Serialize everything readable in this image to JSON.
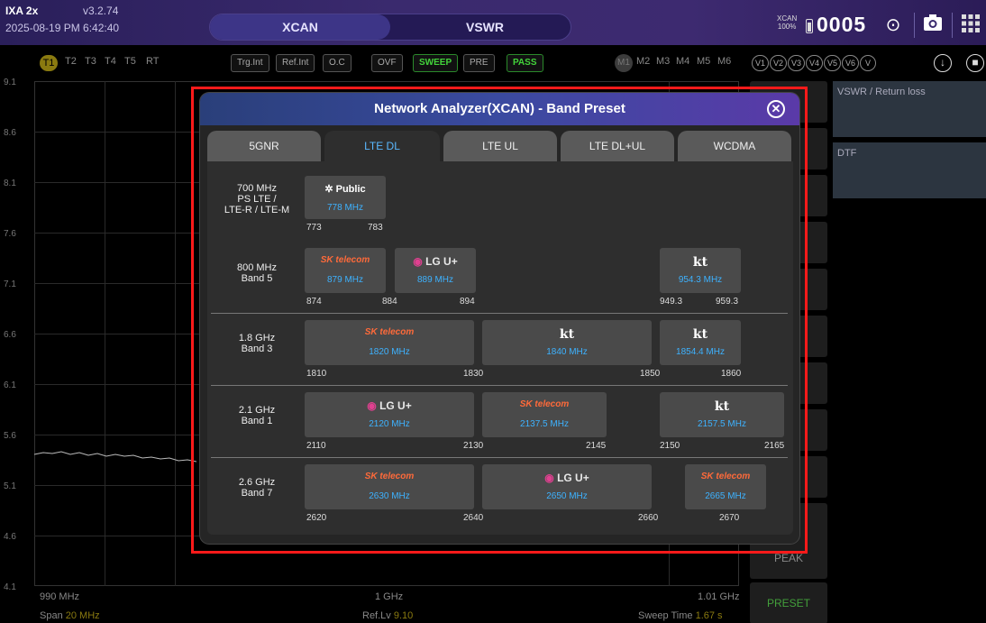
{
  "topbar": {
    "model": "IXA 2x",
    "version": "v3.2.74",
    "datetime": "2025-08-19 PM 6:42:40",
    "mode_a": "XCAN",
    "mode_b": "VSWR",
    "battery_label": "XCAN",
    "battery_pct": "100%",
    "counter": "0005"
  },
  "row2": {
    "traces": [
      "T1",
      "T2",
      "T3",
      "T4",
      "T5",
      "RT"
    ],
    "chips": [
      "Trg.Int",
      "Ref.Int",
      "O.C",
      "OVF",
      "SWEEP",
      "PRE",
      "PASS"
    ],
    "markers": [
      "M1",
      "M2",
      "M3",
      "M4",
      "M5",
      "M6"
    ],
    "vchips": [
      "V1",
      "V2",
      "V3",
      "V4",
      "V5",
      "V6",
      "V"
    ]
  },
  "plot": {
    "y_ticks": [
      "9.1",
      "8.6",
      "8.1",
      "7.6",
      "7.1",
      "6.6",
      "6.1",
      "5.6",
      "5.1",
      "4.6",
      "4.1"
    ],
    "x_start": "990 MHz",
    "x_center": "1 GHz",
    "x_end": "1.01 GHz",
    "span_label": "Span",
    "span_value": "20 MHz",
    "reflv_label": "Ref.Lv",
    "reflv_value": "9.10",
    "sweep_label": "Sweep Time",
    "sweep_value": "1.67 s"
  },
  "softkeys": {
    "peak": "PEAK",
    "preset": "PRESET"
  },
  "right_panel": {
    "vswr": "VSWR / Return loss",
    "dtf": "DTF"
  },
  "modal": {
    "title": "Network Analyzer(XCAN) - Band Preset",
    "tabs": [
      "5GNR",
      "LTE DL",
      "LTE UL",
      "LTE DL+UL",
      "WCDMA"
    ],
    "active_tab": "LTE DL",
    "bands": [
      {
        "name": "700 MHz\nPS LTE /\nLTE-R / LTE-M",
        "cells": [
          {
            "operator": "Public",
            "freq": "778 MHz"
          }
        ],
        "ticks": [
          "773",
          "783"
        ]
      },
      {
        "name": "800 MHz\nBand 5",
        "cells": [
          {
            "operator": "SK telecom",
            "freq": "879 MHz"
          },
          {
            "operator": "LG U+",
            "freq": "889 MHz"
          },
          {
            "operator": "kt",
            "freq": "954.3 MHz"
          }
        ],
        "ticks": [
          "874",
          "884",
          "894",
          "949.3",
          "959.3"
        ]
      },
      {
        "name": "1.8 GHz\nBand 3",
        "cells": [
          {
            "operator": "SK telecom",
            "freq": "1820 MHz"
          },
          {
            "operator": "kt",
            "freq": "1840 MHz"
          },
          {
            "operator": "kt",
            "freq": "1854.4 MHz"
          }
        ],
        "ticks": [
          "1810",
          "1830",
          "1850",
          "1860"
        ]
      },
      {
        "name": "2.1 GHz\nBand 1",
        "cells": [
          {
            "operator": "LG U+",
            "freq": "2120 MHz"
          },
          {
            "operator": "SK telecom",
            "freq": "2137.5 MHz"
          },
          {
            "operator": "kt",
            "freq": "2157.5 MHz"
          }
        ],
        "ticks": [
          "2110",
          "2130",
          "2145",
          "2150",
          "2165"
        ]
      },
      {
        "name": "2.6 GHz\nBand 7",
        "cells": [
          {
            "operator": "SK telecom",
            "freq": "2630 MHz"
          },
          {
            "operator": "LG U+",
            "freq": "2650 MHz"
          },
          {
            "operator": "SK telecom",
            "freq": "2665 MHz"
          }
        ],
        "ticks": [
          "2620",
          "2640",
          "2660",
          "2670"
        ]
      }
    ]
  },
  "colors": {
    "accent_blue": "#3db2ff",
    "highlight_red": "#ff1a1a",
    "pass_green": "#43d43b"
  }
}
